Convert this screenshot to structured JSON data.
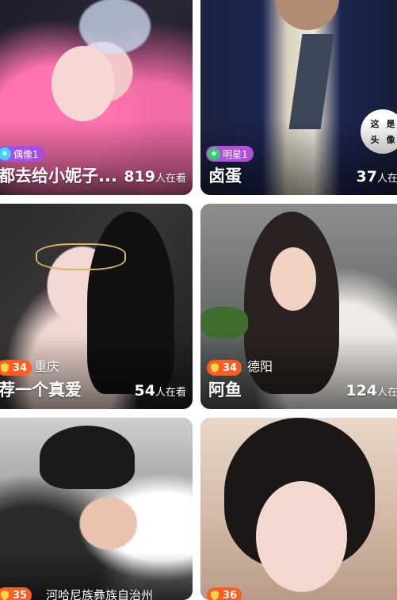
{
  "cards": [
    {
      "title": "都去给小妮子...",
      "viewers": "819",
      "unit": "人在看",
      "badge": "偶像1"
    },
    {
      "title": "卤蛋",
      "viewers": "37",
      "unit": "人在看",
      "badge": "明星1",
      "sticker": [
        "这",
        "是",
        "头",
        "像"
      ]
    },
    {
      "title": "荐一个真爱",
      "viewers": "54",
      "unit": "人在看",
      "level": "34",
      "city": "重庆"
    },
    {
      "title": "阿鱼",
      "viewers": "124",
      "unit": "人在看",
      "level": "34",
      "city": "德阳"
    },
    {
      "level": "35",
      "city": "河哈尼族彝族自治州"
    },
    {
      "level": "36"
    }
  ]
}
